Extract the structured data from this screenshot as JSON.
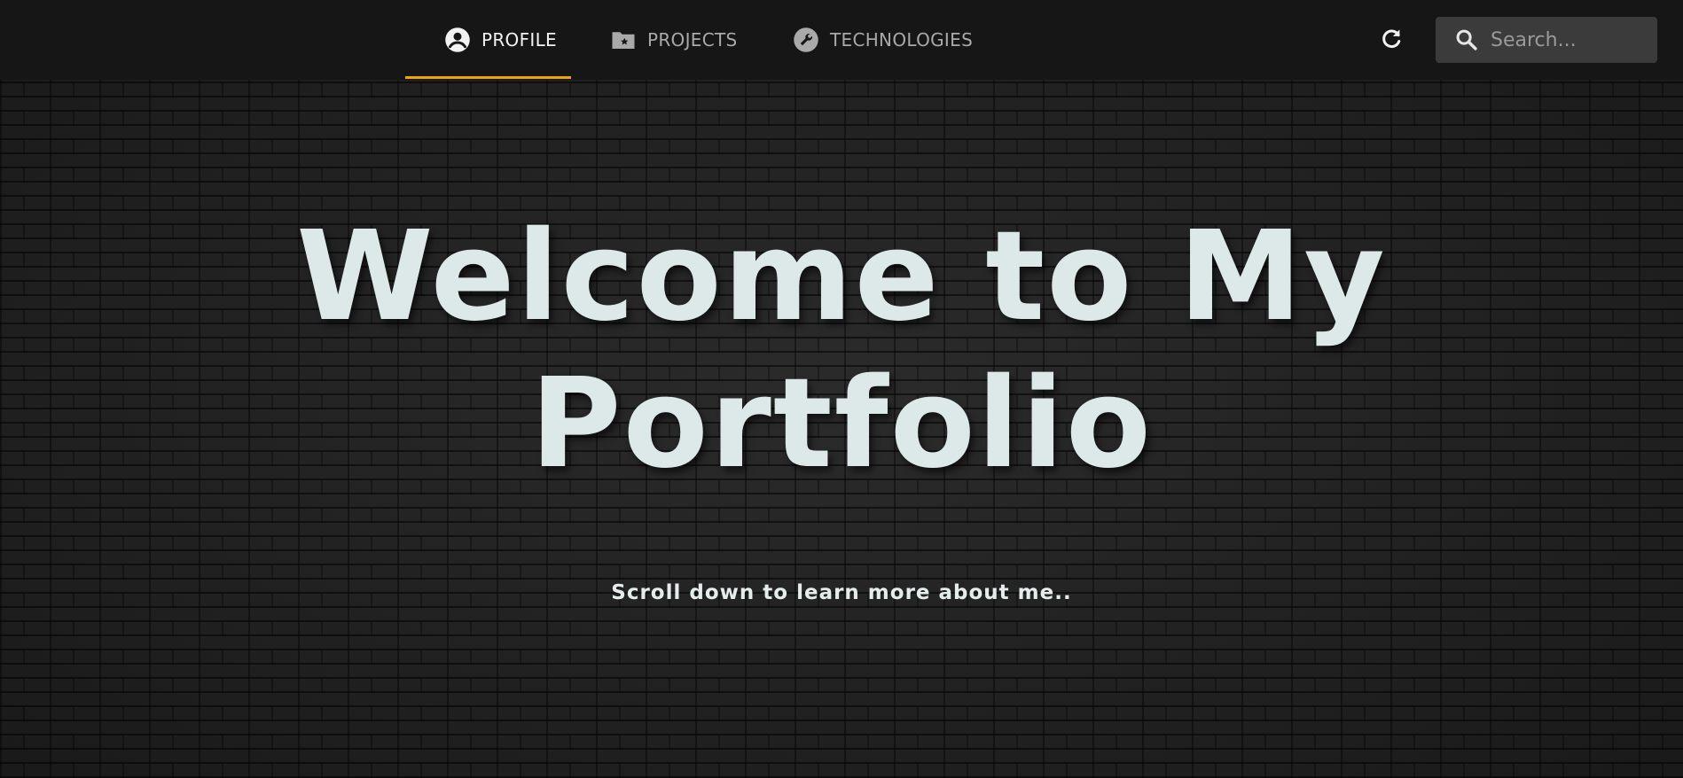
{
  "nav": {
    "tabs": [
      {
        "label": "PROFILE",
        "icon": "account-circle-icon",
        "active": true
      },
      {
        "label": "PROJECTS",
        "icon": "folder-star-icon",
        "active": false
      },
      {
        "label": "TECHNOLOGIES",
        "icon": "wrench-icon",
        "active": false
      }
    ],
    "refresh_icon": "refresh-icon",
    "search": {
      "placeholder": "Search...",
      "value": "",
      "icon": "search-icon"
    }
  },
  "hero": {
    "title_line1": "Welcome to My",
    "title_line2": "Portfolio",
    "subtitle": "Scroll down to learn more about me.."
  },
  "colors": {
    "navbar_bg": "#161616",
    "active_underline": "#f0a500",
    "title_text": "#dde9e9",
    "tab_inactive": "#a9a9a9"
  }
}
